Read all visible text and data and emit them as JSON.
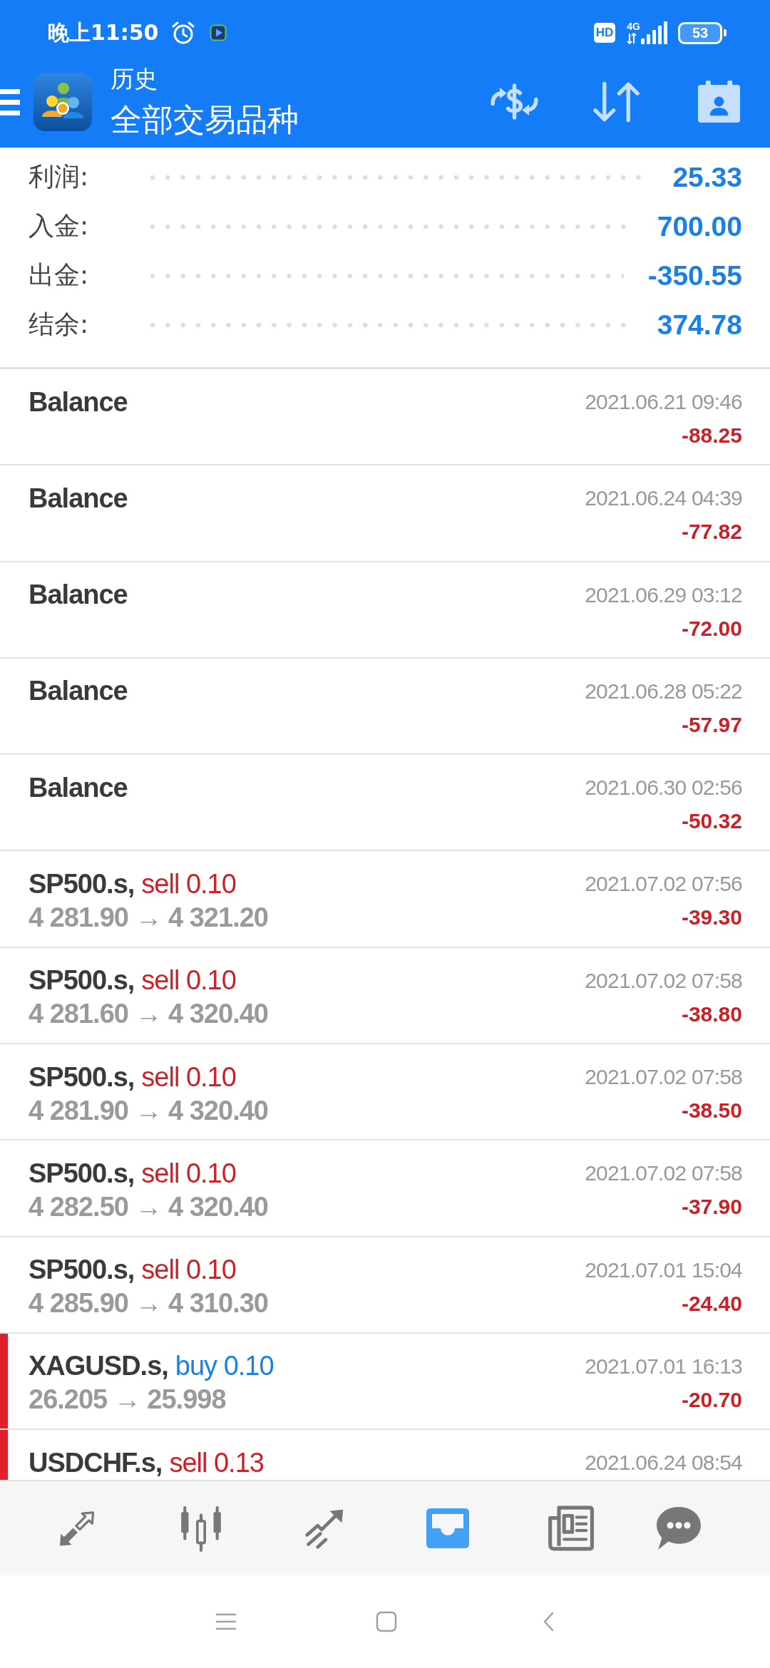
{
  "status_bar": {
    "time": "晚上11:50",
    "hd_badge": "HD",
    "network": "4G",
    "battery": "53"
  },
  "toolbar": {
    "subtitle": "历史",
    "title": "全部交易品种"
  },
  "summary": [
    {
      "label": "利润:",
      "value": "25.33"
    },
    {
      "label": "入金:",
      "value": "700.00"
    },
    {
      "label": "出金:",
      "value": "-350.55"
    },
    {
      "label": "结余:",
      "value": "374.78"
    }
  ],
  "deals": [
    {
      "kind": "balance",
      "flagged": false,
      "symbol": "Balance",
      "time": "2021.06.21 09:46",
      "profit": "-88.25"
    },
    {
      "kind": "balance",
      "flagged": false,
      "symbol": "Balance",
      "time": "2021.06.24 04:39",
      "profit": "-77.82"
    },
    {
      "kind": "balance",
      "flagged": false,
      "symbol": "Balance",
      "time": "2021.06.29 03:12",
      "profit": "-72.00"
    },
    {
      "kind": "balance",
      "flagged": false,
      "symbol": "Balance",
      "time": "2021.06.28 05:22",
      "profit": "-57.97"
    },
    {
      "kind": "balance",
      "flagged": false,
      "symbol": "Balance",
      "time": "2021.06.30 02:56",
      "profit": "-50.32"
    },
    {
      "kind": "sell",
      "flagged": false,
      "symbol": "SP500.s,",
      "order": "sell 0.10",
      "time": "2021.07.02 07:56",
      "prices": "4 281.90 → 4 321.20",
      "profit": "-39.30"
    },
    {
      "kind": "sell",
      "flagged": false,
      "symbol": "SP500.s,",
      "order": "sell 0.10",
      "time": "2021.07.02 07:58",
      "prices": "4 281.60 → 4 320.40",
      "profit": "-38.80"
    },
    {
      "kind": "sell",
      "flagged": false,
      "symbol": "SP500.s,",
      "order": "sell 0.10",
      "time": "2021.07.02 07:58",
      "prices": "4 281.90 → 4 320.40",
      "profit": "-38.50"
    },
    {
      "kind": "sell",
      "flagged": false,
      "symbol": "SP500.s,",
      "order": "sell 0.10",
      "time": "2021.07.02 07:58",
      "prices": "4 282.50 → 4 320.40",
      "profit": "-37.90"
    },
    {
      "kind": "sell",
      "flagged": false,
      "symbol": "SP500.s,",
      "order": "sell 0.10",
      "time": "2021.07.01 15:04",
      "prices": "4 285.90 → 4 310.30",
      "profit": "-24.40"
    },
    {
      "kind": "buy",
      "flagged": true,
      "symbol": "XAGUSD.s,",
      "order": "buy 0.10",
      "time": "2021.07.01 16:13",
      "prices": "26.205 → 25.998",
      "profit": "-20.70"
    },
    {
      "kind": "sell",
      "flagged": true,
      "symbol": "USDCHF.s,",
      "order": "sell 0.13",
      "time": "2021.06.24 08:54"
    }
  ],
  "bottom_nav": [
    {
      "kind": "arrows",
      "selected": false
    },
    {
      "kind": "candles",
      "selected": false
    },
    {
      "kind": "trend",
      "selected": false
    },
    {
      "kind": "inbox",
      "selected": true
    },
    {
      "kind": "news",
      "selected": false
    },
    {
      "kind": "chat",
      "selected": false
    }
  ]
}
